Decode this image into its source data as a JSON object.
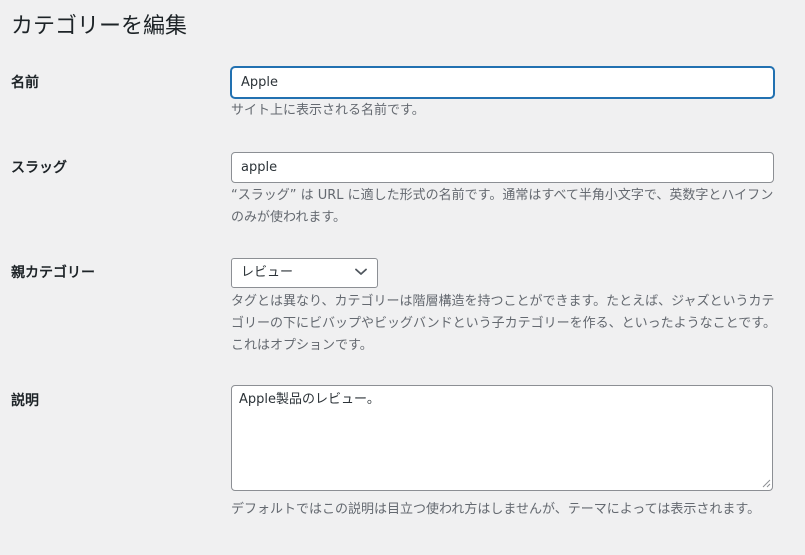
{
  "page": {
    "title": "カテゴリーを編集"
  },
  "fields": {
    "name": {
      "label": "名前",
      "value": "Apple",
      "description": "サイト上に表示される名前です。"
    },
    "slug": {
      "label": "スラッグ",
      "value": "apple",
      "description": "“スラッグ” は URL に適した形式の名前です。通常はすべて半角小文字で、英数字とハイフンのみが使われます。"
    },
    "parent": {
      "label": "親カテゴリー",
      "selected": "レビュー",
      "description": "タグとは異なり、カテゴリーは階層構造を持つことができます。たとえば、ジャズというカテゴリーの下にビバップやビッグバンドという子カテゴリーを作る、といったようなことです。これはオプションです。"
    },
    "description": {
      "label": "説明",
      "value": "Apple製品のレビュー。",
      "description": "デフォルトではこの説明は目立つ使われ方はしませんが、テーマによっては表示されます。"
    }
  },
  "icons": {
    "dropdown": "chevron-down-icon",
    "resize": "resize-handle-icon"
  },
  "colors": {
    "background": "#f0f0f1",
    "focus_border": "#2271b1",
    "description_text": "#646970",
    "label_text": "#1d2327"
  }
}
